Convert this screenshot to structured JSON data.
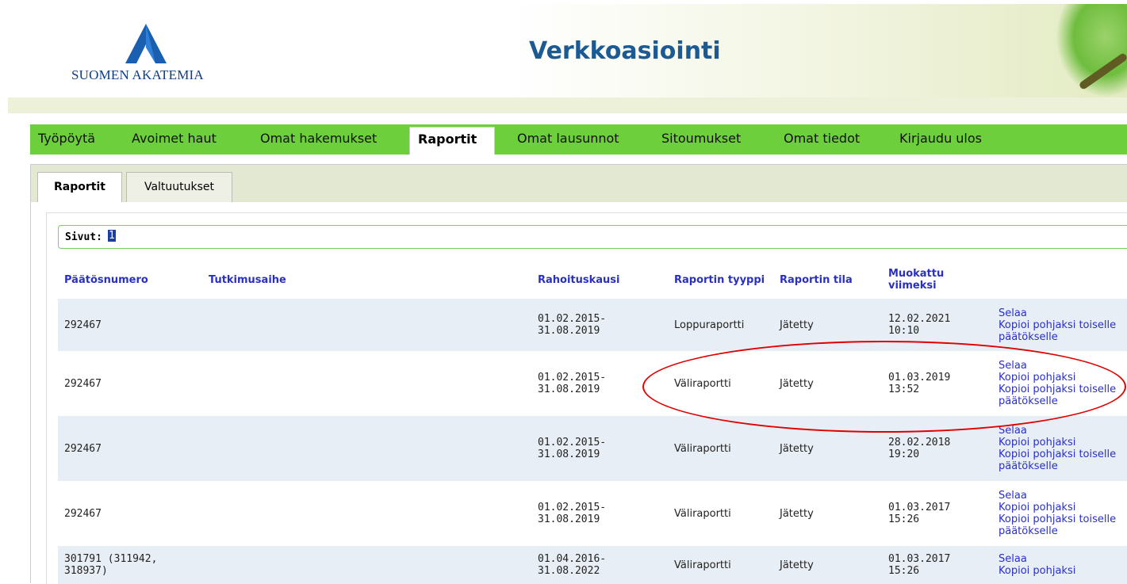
{
  "header": {
    "logo_text": "SUOMEN AKATEMIA",
    "app_title": "Verkkoasiointi"
  },
  "nav": [
    {
      "label": "Työpöytä"
    },
    {
      "label": "Avoimet haut"
    },
    {
      "label": "Omat hakemukset"
    },
    {
      "label": "Raportit"
    },
    {
      "label": "Omat lausunnot"
    },
    {
      "label": "Sitoumukset"
    },
    {
      "label": "Omat tiedot"
    },
    {
      "label": "Kirjaudu ulos"
    }
  ],
  "subtabs": [
    {
      "label": "Raportit"
    },
    {
      "label": "Valtuutukset"
    }
  ],
  "pager": {
    "label": "Sivut:",
    "page": "1"
  },
  "table": {
    "headers": [
      "Päätösnumero",
      "Tutkimusaihe",
      "Rahoituskausi",
      "Raportin tyyppi",
      "Raportin tila",
      "Muokattu viimeksi"
    ],
    "rows": [
      {
        "number": "292467",
        "topic": "",
        "period_start": "01.02.2015-",
        "period_end": "31.08.2019",
        "type": "Loppuraportti",
        "state": "Jätetty",
        "modified_date": "12.02.2021",
        "modified_time": "10:10",
        "actions": [
          "Selaa",
          "Kopioi pohjaksi toiselle päätökselle"
        ]
      },
      {
        "number": "292467",
        "topic": "",
        "period_start": "01.02.2015-",
        "period_end": "31.08.2019",
        "type": "Väliraportti",
        "state": "Jätetty",
        "modified_date": "01.03.2019",
        "modified_time": "13:52",
        "actions": [
          "Selaa",
          "Kopioi pohjaksi",
          "Kopioi pohjaksi toiselle päätökselle"
        ]
      },
      {
        "number": "292467",
        "topic": "",
        "period_start": "01.02.2015-",
        "period_end": "31.08.2019",
        "type": "Väliraportti",
        "state": "Jätetty",
        "modified_date": "28.02.2018",
        "modified_time": "19:20",
        "actions": [
          "Selaa",
          "Kopioi pohjaksi",
          "Kopioi pohjaksi toiselle päätökselle"
        ]
      },
      {
        "number": "292467",
        "topic": "",
        "period_start": "01.02.2015-",
        "period_end": "31.08.2019",
        "type": "Väliraportti",
        "state": "Jätetty",
        "modified_date": "01.03.2017",
        "modified_time": "15:26",
        "actions": [
          "Selaa",
          "Kopioi pohjaksi",
          "Kopioi pohjaksi toiselle päätökselle"
        ]
      },
      {
        "number": "301791 (311942, 318937)",
        "topic": "",
        "period_start": "01.04.2016-",
        "period_end": "31.08.2022",
        "type": "Väliraportti",
        "state": "Jätetty",
        "modified_date": "01.03.2017",
        "modified_time": "15:26",
        "actions": [
          "Selaa",
          "Kopioi pohjaksi"
        ]
      }
    ]
  },
  "colors": {
    "nav_green": "#6ccf3b",
    "link_blue": "#2a2fc6",
    "annotation_red": "#e00000",
    "title_blue": "#1b5a92"
  }
}
